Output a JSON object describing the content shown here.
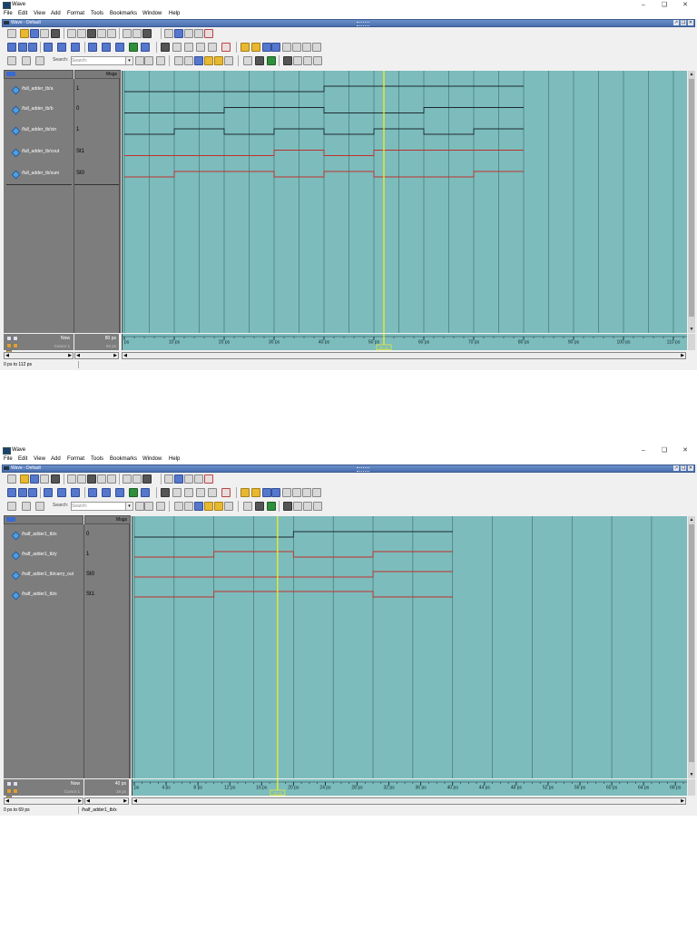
{
  "app": {
    "title": "Wave",
    "subwindow_title": "Wave - Default"
  },
  "menu": [
    "File",
    "Edit",
    "View",
    "Add",
    "Format",
    "Tools",
    "Bookmarks",
    "Window",
    "Help"
  ],
  "toolbar": {
    "search_placeholder": "Search:"
  },
  "colors": {
    "wave_bg": "#7cbcbc",
    "signal_dark": "#1b2a30",
    "signal_red": "#c0302a",
    "cursor": "#f2ee22",
    "grid": "#3d6b6b"
  },
  "panels": [
    {
      "header": {
        "msgs": "Msgs"
      },
      "signals": [
        {
          "name": "/full_adder_tb/a",
          "value": "1",
          "color": "dark",
          "levels": [
            0,
            0,
            0,
            0,
            0,
            0,
            0,
            0,
            1,
            1,
            1,
            1,
            1,
            1,
            1,
            1
          ]
        },
        {
          "name": "/full_adder_tb/b",
          "value": "0",
          "color": "dark",
          "levels": [
            0,
            0,
            0,
            0,
            1,
            1,
            1,
            1,
            0,
            0,
            0,
            0,
            1,
            1,
            1,
            1
          ]
        },
        {
          "name": "/full_adder_tb/cin",
          "value": "1",
          "color": "dark",
          "levels": [
            0,
            0,
            1,
            1,
            0,
            0,
            1,
            1,
            0,
            0,
            1,
            1,
            0,
            0,
            1,
            1
          ]
        },
        {
          "name": "/full_adder_tb/cout",
          "value": "St1",
          "color": "red",
          "levels": [
            0,
            0,
            0,
            0,
            0,
            0,
            1,
            1,
            0,
            0,
            1,
            1,
            1,
            1,
            1,
            1
          ]
        },
        {
          "name": "/full_adder_tb/sum",
          "value": "St0",
          "color": "red",
          "levels": [
            0,
            0,
            1,
            1,
            1,
            1,
            0,
            0,
            1,
            1,
            0,
            0,
            0,
            0,
            1,
            1
          ]
        }
      ],
      "now": {
        "label": "Now",
        "value": "80 ps"
      },
      "cursor": {
        "label": "Cursor 1",
        "value": "52 ps",
        "time": 52
      },
      "time_axis": {
        "min": 0,
        "max": 112,
        "tick_labels": [
          {
            "t": 0,
            "label": "ps"
          },
          {
            "t": 10,
            "label": "10 ps"
          },
          {
            "t": 20,
            "label": "20 ps"
          },
          {
            "t": 30,
            "label": "30 ps"
          },
          {
            "t": 40,
            "label": "40 ps"
          },
          {
            "t": 50,
            "label": "50 ps"
          },
          {
            "t": 60,
            "label": "60 ps"
          },
          {
            "t": 70,
            "label": "70 ps"
          },
          {
            "t": 80,
            "label": "80 ps"
          },
          {
            "t": 90,
            "label": "90 ps"
          },
          {
            "t": 100,
            "label": "100 ps"
          },
          {
            "t": 110,
            "label": "110 ps"
          }
        ],
        "cursor_tag": "52 ps",
        "signal_end": 80,
        "grid_step": 5
      },
      "status": {
        "range": "0 ps to 112 ps",
        "selected": ""
      }
    },
    {
      "header": {
        "msgs": "Msgs"
      },
      "signals": [
        {
          "name": "/half_adder1_tb/x",
          "value": "0",
          "color": "dark",
          "levels": [
            0,
            0,
            0,
            0,
            1,
            1,
            1,
            1
          ]
        },
        {
          "name": "/half_adder1_tb/y",
          "value": "1",
          "color": "red",
          "levels": [
            0,
            0,
            1,
            1,
            0,
            0,
            1,
            1
          ]
        },
        {
          "name": "/half_adder1_tb/carry_out",
          "value": "St0",
          "color": "red",
          "levels": [
            0,
            0,
            0,
            0,
            0,
            0,
            1,
            1
          ]
        },
        {
          "name": "/half_adder1_tb/s",
          "value": "St1",
          "color": "red",
          "levels": [
            0,
            0,
            1,
            1,
            1,
            1,
            0,
            0
          ]
        }
      ],
      "now": {
        "label": "Now",
        "value": "40 ps"
      },
      "cursor": {
        "label": "Cursor 1",
        "value": "18 ps",
        "time": 18
      },
      "time_axis": {
        "min": 0,
        "max": 69,
        "tick_labels": [
          {
            "t": 0,
            "label": "ps"
          },
          {
            "t": 4,
            "label": "4 ps"
          },
          {
            "t": 8,
            "label": "8 ps"
          },
          {
            "t": 12,
            "label": "12 ps"
          },
          {
            "t": 16,
            "label": "16 ps"
          },
          {
            "t": 20,
            "label": "20 ps"
          },
          {
            "t": 24,
            "label": "24 ps"
          },
          {
            "t": 28,
            "label": "28 ps"
          },
          {
            "t": 32,
            "label": "32 ps"
          },
          {
            "t": 36,
            "label": "36 ps"
          },
          {
            "t": 40,
            "label": "40 ps"
          },
          {
            "t": 44,
            "label": "44 ps"
          },
          {
            "t": 48,
            "label": "48 ps"
          },
          {
            "t": 52,
            "label": "52 ps"
          },
          {
            "t": 56,
            "label": "56 ps"
          },
          {
            "t": 60,
            "label": "60 ps"
          },
          {
            "t": 64,
            "label": "64 ps"
          },
          {
            "t": 68,
            "label": "68 ps"
          }
        ],
        "cursor_tag": "18 ps",
        "signal_end": 40,
        "grid_step": 5
      },
      "status": {
        "range": "0 ps to 69 ps",
        "selected": "/half_adder1_tb/x"
      }
    }
  ]
}
